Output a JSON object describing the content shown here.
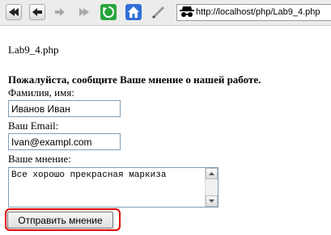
{
  "browser": {
    "url": "http://localhost/php/Lab9_4.php",
    "buttons": {
      "back": "back-icon",
      "forward": "forward-icon",
      "stop": "stop-icon",
      "fast_forward": "fast-forward-icon",
      "reload": "reload-icon",
      "home": "home-icon",
      "edit": "pen-icon"
    }
  },
  "page": {
    "heading": "Lab9_4.php",
    "prompt": "Пожалуйста, сообщите Ваше мнение о нашей работе.",
    "name_label": "Фамилия, имя:",
    "name_value": "Иванов Иван",
    "email_label": "Ваш Email:",
    "email_value": "Ivan@exampl.com",
    "opinion_label": "Ваше мнение:",
    "opinion_value": "Все хорошо прекрасная маркиза",
    "submit_label": "Отправить мнение"
  },
  "colors": {
    "highlight": "#e00000",
    "reload_green": "#27a53a",
    "home_blue": "#2f6fd6"
  }
}
